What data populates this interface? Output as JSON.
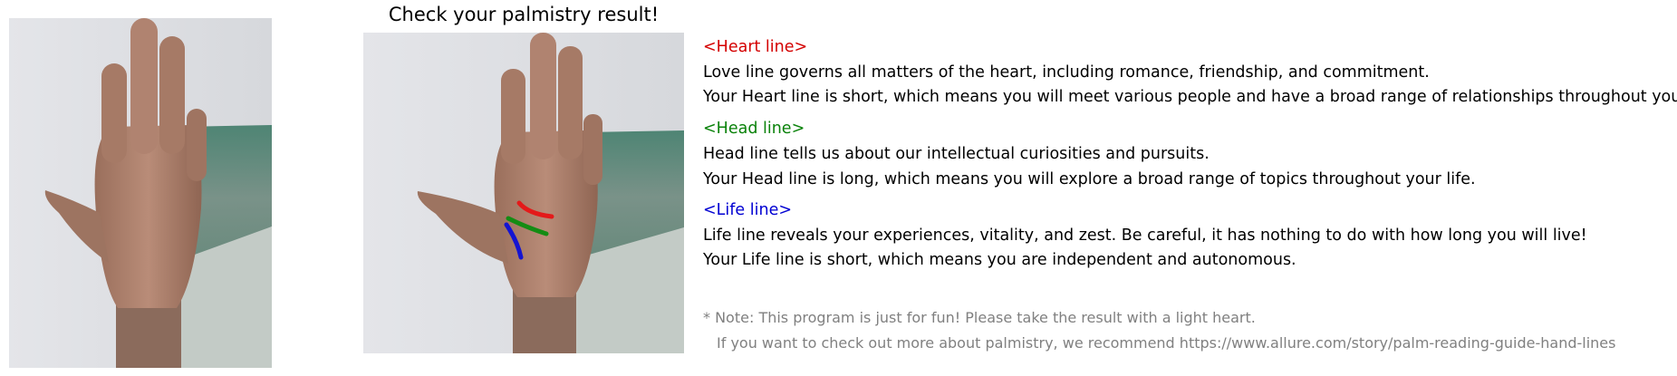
{
  "title": "Check your palmistry result!",
  "colors": {
    "heart": "#d40000",
    "head": "#0a820a",
    "life": "#0000d2",
    "note": "#808080"
  },
  "sections": {
    "heart": {
      "heading": "<Heart line>",
      "description": "Love line governs all matters of the heart, including romance, friendship, and commitment.",
      "result": "Your Heart line is short, which means you will meet various people and have a broad range of relationships throughout your life."
    },
    "head": {
      "heading": "<Head line>",
      "description": "Head line tells us about our intellectual curiosities and pursuits.",
      "result": "Your Head line is long, which means you will explore a broad range of topics throughout your life."
    },
    "life": {
      "heading": "<Life line>",
      "description": "Life line reveals your experiences, vitality, and zest. Be careful, it has nothing to do with how long you will live!",
      "result": "Your Life line is short, which means you are independent and autonomous."
    }
  },
  "note": {
    "line1": "* Note: This program is just for fun! Please take the result with a light heart.",
    "line2": "If you want to check out more about palmistry, we recommend https://www.allure.com/story/palm-reading-guide-hand-lines"
  }
}
